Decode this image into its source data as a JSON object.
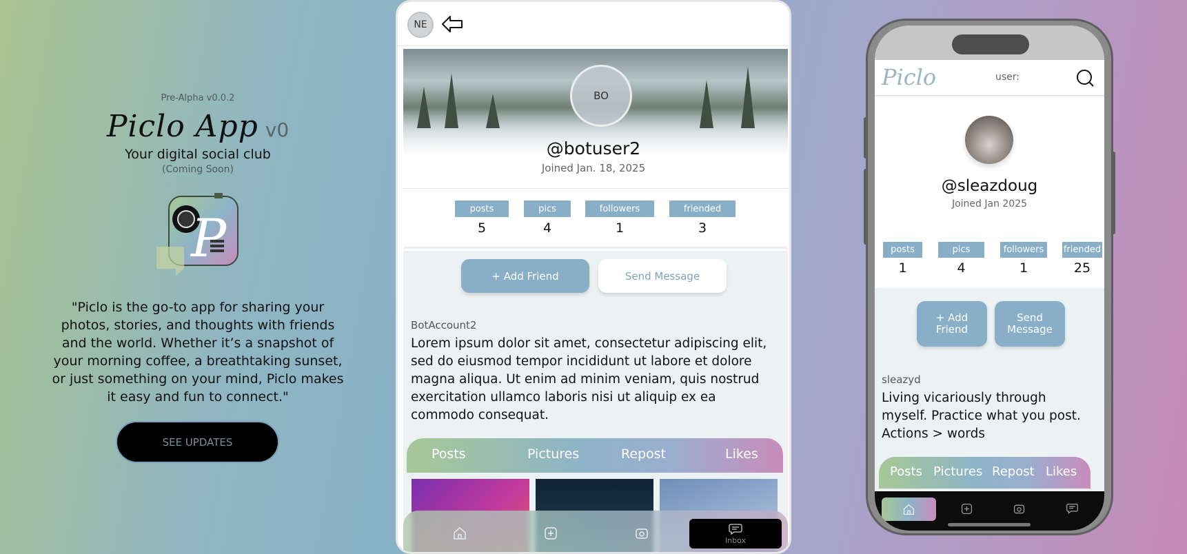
{
  "promo": {
    "version": "Pre-Alpha v0.0.2",
    "brand_name": "Piclo App",
    "brand_version": "v0",
    "tagline": "Your digital social club",
    "coming_soon": "(Coming Soon)",
    "quote": "\"Piclo is the go-to app for sharing your photos, stories, and thoughts with friends and the world. Whether it’s a snapshot of your morning coffee, a breathtaking sunset, or just something on your mind, Piclo makes it easy and fun to connect.\"",
    "updates_button": "SEE UPDATES"
  },
  "tablet": {
    "viewer_initials": "NE",
    "profile_initials": "BO",
    "handle": "@botuser2",
    "joined": "Joined Jan. 18, 2025",
    "stats": [
      {
        "label": "posts",
        "value": "5"
      },
      {
        "label": "pics",
        "value": "4"
      },
      {
        "label": "followers",
        "value": "1"
      },
      {
        "label": "friended",
        "value": "3"
      }
    ],
    "add_friend": "+ Add Friend",
    "send_message": "Send Message",
    "display_name": "BotAccount2",
    "bio": "Lorem ipsum dolor sit amet, consectetur adipiscing elit, sed do eiusmod tempor incididunt ut labore et dolore magna aliqua. Ut enim ad minim veniam, quis nostrud exercitation ullamco laboris nisi ut aliquip ex ea commodo consequat.",
    "tabs": [
      "Posts",
      "Pictures",
      "Repost",
      "Likes"
    ],
    "nav": {
      "inbox_label": "Inbox"
    }
  },
  "phone": {
    "logo": "Piclo",
    "user_label": "user:",
    "handle": "@sleazdoug",
    "joined": "Joined Jan 2025",
    "stats": [
      {
        "label": "posts",
        "value": "1"
      },
      {
        "label": "pics",
        "value": "4"
      },
      {
        "label": "followers",
        "value": "1"
      },
      {
        "label": "friended",
        "value": "25"
      }
    ],
    "add_friend": "+ Add Friend",
    "send_message": "Send Message",
    "display_name": "sleazyd",
    "bio": "Living vicariously through myself. Practice what you post. Actions > words",
    "tabs": [
      "Posts",
      "Pictures",
      "Repost",
      "Likes"
    ]
  },
  "colors": {
    "accent": "#88afc7",
    "gradient_green": "#a6c895",
    "gradient_pink": "#c88cbb"
  }
}
